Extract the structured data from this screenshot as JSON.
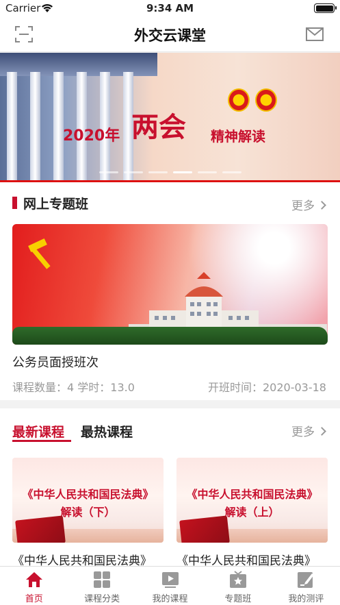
{
  "status_bar": {
    "carrier": "Carrier",
    "time": "9:34 AM"
  },
  "nav": {
    "title": "外交云课堂",
    "scan_icon": "scan-icon",
    "mail_icon": "mail-icon"
  },
  "banner": {
    "year": "2020年",
    "headline": "两会",
    "subtitle": "精神解读",
    "slide_count": 6,
    "active_slide": 4
  },
  "special_class": {
    "section_title": "网上专题班",
    "more_label": "更多",
    "course_name": "公务员面授班次",
    "meta": "课程数量：4 学时：13.0",
    "start_date": "开班时间：2020-03-18"
  },
  "courses": {
    "tab_latest": "最新课程",
    "tab_hot": "最热课程",
    "more_label": "更多",
    "items": [
      {
        "thumb_title": "《中华人民共和国民法典》",
        "thumb_sub": "解读（下）",
        "caption": "《中华人民共和国民法典》"
      },
      {
        "thumb_title": "《中华人民共和国民法典》",
        "thumb_sub": "解读（上）",
        "caption": "《中华人民共和国民法典》"
      }
    ]
  },
  "tabbar": {
    "items": [
      {
        "label": "首页",
        "icon": "home-icon",
        "active": true
      },
      {
        "label": "课程分类",
        "icon": "grid-icon",
        "active": false
      },
      {
        "label": "我的课程",
        "icon": "play-icon",
        "active": false
      },
      {
        "label": "专题班",
        "icon": "star-tv-icon",
        "active": false
      },
      {
        "label": "我的测评",
        "icon": "edit-icon",
        "active": false
      }
    ]
  },
  "colors": {
    "accent": "#c8102e",
    "muted": "#999999",
    "background": "#f2f2f2"
  }
}
